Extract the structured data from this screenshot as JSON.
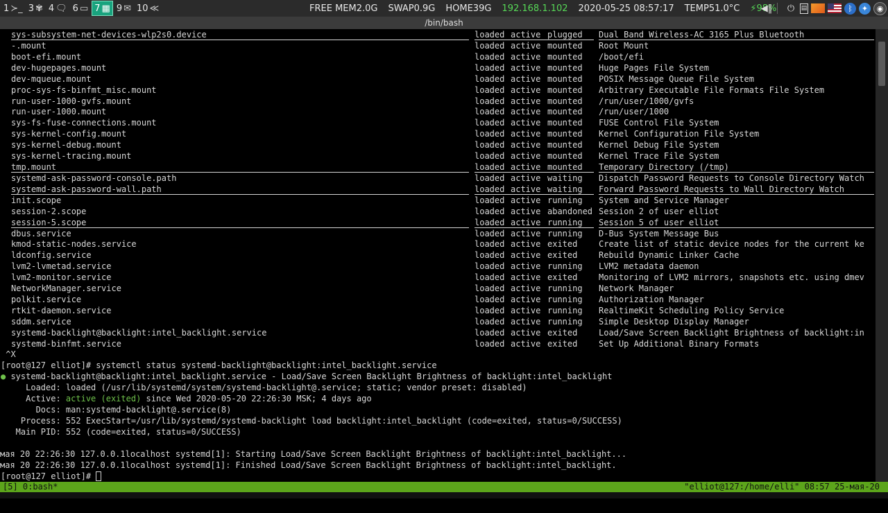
{
  "topbar": {
    "workspaces": [
      {
        "num": "1",
        "icon": "≻_",
        "icon_name": "terminal-icon",
        "active": false
      },
      {
        "num": "3",
        "icon": "✾",
        "icon_name": "settings-gear-icon",
        "active": false
      },
      {
        "num": "4",
        "icon": "🗨",
        "icon_name": "chat-icon",
        "active": false
      },
      {
        "num": "6",
        "icon": "▭",
        "icon_name": "document-icon",
        "active": false
      },
      {
        "num": "7",
        "icon": "▦",
        "icon_name": "calculator-icon",
        "active": true
      },
      {
        "num": "9",
        "icon": "✉",
        "icon_name": "mail-icon",
        "active": false
      },
      {
        "num": "10",
        "icon": "≪",
        "icon_name": "chevron-double-icon",
        "active": false
      }
    ],
    "free_mem": "FREE MEM2.0G",
    "swap": "SWAP0.9G",
    "home": "HOME39G",
    "ip": "192.168.1.102",
    "datetime": "2020-05-25 08:57:17",
    "temp": "TEMP51.0°C",
    "battery": "⚡98%",
    "colors": {
      "accent": "#19a37e",
      "ip": "#57d957",
      "status_bar": "#5ca51b"
    }
  },
  "window": {
    "title": "/bin/bash"
  },
  "units": [
    {
      "unit": "sys-subsystem-net-devices-wlp2s0.device",
      "load": "loaded",
      "active": "active",
      "sub": "plugged",
      "desc": "Dual Band Wireless-AC 3165 Plus Bluetooth",
      "hl": true
    },
    {
      "unit": "-.mount",
      "load": "loaded",
      "active": "active",
      "sub": "mounted",
      "desc": "Root Mount",
      "hl": false
    },
    {
      "unit": "boot-efi.mount",
      "load": "loaded",
      "active": "active",
      "sub": "mounted",
      "desc": "/boot/efi",
      "hl": false
    },
    {
      "unit": "dev-hugepages.mount",
      "load": "loaded",
      "active": "active",
      "sub": "mounted",
      "desc": "Huge Pages File System",
      "hl": false
    },
    {
      "unit": "dev-mqueue.mount",
      "load": "loaded",
      "active": "active",
      "sub": "mounted",
      "desc": "POSIX Message Queue File System",
      "hl": false
    },
    {
      "unit": "proc-sys-fs-binfmt_misc.mount",
      "load": "loaded",
      "active": "active",
      "sub": "mounted",
      "desc": "Arbitrary Executable File Formats File System",
      "hl": false
    },
    {
      "unit": "run-user-1000-gvfs.mount",
      "load": "loaded",
      "active": "active",
      "sub": "mounted",
      "desc": "/run/user/1000/gvfs",
      "hl": false
    },
    {
      "unit": "run-user-1000.mount",
      "load": "loaded",
      "active": "active",
      "sub": "mounted",
      "desc": "/run/user/1000",
      "hl": false
    },
    {
      "unit": "sys-fs-fuse-connections.mount",
      "load": "loaded",
      "active": "active",
      "sub": "mounted",
      "desc": "FUSE Control File System",
      "hl": false
    },
    {
      "unit": "sys-kernel-config.mount",
      "load": "loaded",
      "active": "active",
      "sub": "mounted",
      "desc": "Kernel Configuration File System",
      "hl": false
    },
    {
      "unit": "sys-kernel-debug.mount",
      "load": "loaded",
      "active": "active",
      "sub": "mounted",
      "desc": "Kernel Debug File System",
      "hl": false
    },
    {
      "unit": "sys-kernel-tracing.mount",
      "load": "loaded",
      "active": "active",
      "sub": "mounted",
      "desc": "Kernel Trace File System",
      "hl": false
    },
    {
      "unit": "tmp.mount",
      "load": "loaded",
      "active": "active",
      "sub": "mounted",
      "desc": "Temporary Directory (/tmp)",
      "hl": true
    },
    {
      "unit": "systemd-ask-password-console.path",
      "load": "loaded",
      "active": "active",
      "sub": "waiting",
      "desc": "Dispatch Password Requests to Console Directory Watch",
      "hl": false
    },
    {
      "unit": "systemd-ask-password-wall.path",
      "load": "loaded",
      "active": "active",
      "sub": "waiting",
      "desc": "Forward Password Requests to Wall Directory Watch",
      "hl": true
    },
    {
      "unit": "init.scope",
      "load": "loaded",
      "active": "active",
      "sub": "running",
      "desc": "System and Service Manager",
      "hl": false
    },
    {
      "unit": "session-2.scope",
      "load": "loaded",
      "active": "active",
      "sub": "abandoned",
      "desc": "Session 2 of user elliot",
      "hl": false
    },
    {
      "unit": "session-5.scope",
      "load": "loaded",
      "active": "active",
      "sub": "running",
      "desc": "Session 5 of user elliot",
      "hl": true
    },
    {
      "unit": "dbus.service",
      "load": "loaded",
      "active": "active",
      "sub": "running",
      "desc": "D-Bus System Message Bus",
      "hl": false
    },
    {
      "unit": "kmod-static-nodes.service",
      "load": "loaded",
      "active": "active",
      "sub": "exited",
      "desc": "Create list of static device nodes for the current ke",
      "hl": false
    },
    {
      "unit": "ldconfig.service",
      "load": "loaded",
      "active": "active",
      "sub": "exited",
      "desc": "Rebuild Dynamic Linker Cache",
      "hl": false
    },
    {
      "unit": "lvm2-lvmetad.service",
      "load": "loaded",
      "active": "active",
      "sub": "running",
      "desc": "LVM2 metadata daemon",
      "hl": false
    },
    {
      "unit": "lvm2-monitor.service",
      "load": "loaded",
      "active": "active",
      "sub": "exited",
      "desc": "Monitoring of LVM2 mirrors, snapshots etc. using dmev",
      "hl": false
    },
    {
      "unit": "NetworkManager.service",
      "load": "loaded",
      "active": "active",
      "sub": "running",
      "desc": "Network Manager",
      "hl": false
    },
    {
      "unit": "polkit.service",
      "load": "loaded",
      "active": "active",
      "sub": "running",
      "desc": "Authorization Manager",
      "hl": false
    },
    {
      "unit": "rtkit-daemon.service",
      "load": "loaded",
      "active": "active",
      "sub": "running",
      "desc": "RealtimeKit Scheduling Policy Service",
      "hl": false
    },
    {
      "unit": "sddm.service",
      "load": "loaded",
      "active": "active",
      "sub": "running",
      "desc": "Simple Desktop Display Manager",
      "hl": false
    },
    {
      "unit": "systemd-backlight@backlight:intel_backlight.service",
      "load": "loaded",
      "active": "active",
      "sub": "exited",
      "desc": "Load/Save Screen Backlight Brightness of backlight:in",
      "hl": false
    },
    {
      "unit": "systemd-binfmt.service",
      "load": "loaded",
      "active": "active",
      "sub": "exited",
      "desc": "Set Up Additional Binary Formats",
      "hl": false
    }
  ],
  "output": {
    "ctrl_x": " ^X",
    "prompt_cmd": "[root@127 elliot]# systemctl status systemd-backlight@backlight:intel_backlight.service",
    "dot": "●",
    "status_head": " systemd-backlight@backlight:intel_backlight.service - Load/Save Screen Backlight Brightness of backlight:intel_backlight",
    "loaded_line": "     Loaded: loaded (/usr/lib/systemd/system/systemd-backlight@.service; static; vendor preset: disabled)",
    "active_label": "     Active: ",
    "active_state": "active (exited)",
    "active_rest": " since Wed 2020-05-20 22:26:30 MSK; 4 days ago",
    "docs_line": "       Docs: man:systemd-backlight@.service(8)",
    "process_line": "    Process: 552 ExecStart=/usr/lib/systemd/systemd-backlight load backlight:intel_backlight (code=exited, status=0/SUCCESS)",
    "mainpid_line": "   Main PID: 552 (code=exited, status=0/SUCCESS)",
    "log1": "мая 20 22:26:30 127.0.0.1localhost systemd[1]: Starting Load/Save Screen Backlight Brightness of backlight:intel_backlight...",
    "log2": "мая 20 22:26:30 127.0.0.1localhost systemd[1]: Finished Load/Save Screen Backlight Brightness of backlight:intel_backlight.",
    "prompt_final": "[root@127 elliot]# "
  },
  "statusbar": {
    "left": "[5] 0:bash*",
    "right": "\"elliot@127:/home/elli\" 08:57 25-мая-20"
  }
}
